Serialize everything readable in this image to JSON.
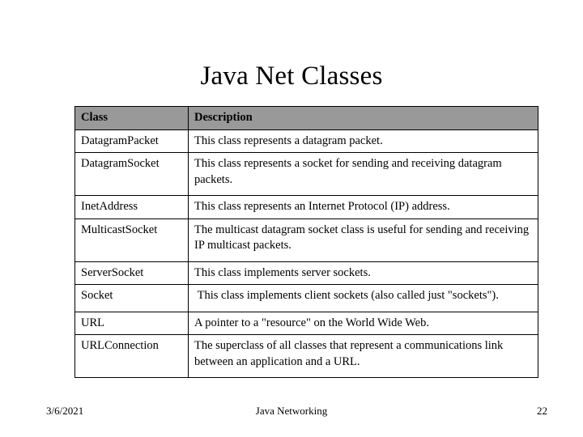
{
  "slide": {
    "title": "Java Net Classes",
    "background_color": "#ffffff",
    "text_color": "#000000"
  },
  "table": {
    "header_background": "#999999",
    "border_color": "#000000",
    "columns": [
      "Class",
      "Description"
    ],
    "rows": [
      {
        "class": "DatagramPacket",
        "description": "This class represents a datagram packet."
      },
      {
        "class": "DatagramSocket",
        "description": "This class represents a socket for sending and receiving datagram packets."
      },
      {
        "class": "InetAddress",
        "description": "This class represents an Internet Protocol (IP) address."
      },
      {
        "class": "MulticastSocket",
        "description": "The multicast datagram socket class is useful for sending and receiving IP multicast packets."
      },
      {
        "class": "ServerSocket",
        "description": "This class implements server sockets."
      },
      {
        "class": "Socket",
        "description": " This class implements client sockets (also called just \"sockets\")."
      },
      {
        "class": "URL",
        "description": "A pointer to a \"resource\" on the World Wide Web."
      },
      {
        "class": "URLConnection",
        "description": "The superclass of all classes that represent a communications link between an application and a URL."
      }
    ]
  },
  "footer": {
    "date": "3/6/2021",
    "center": "Java Networking",
    "page_number": "22"
  }
}
